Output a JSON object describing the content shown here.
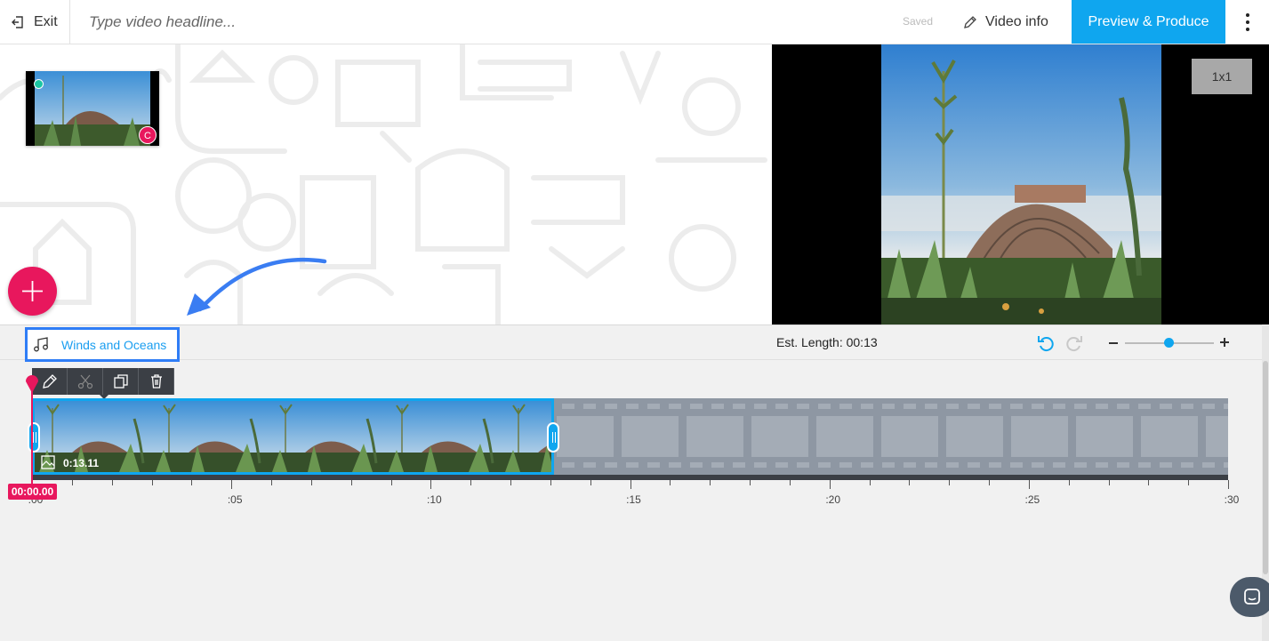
{
  "topbar": {
    "exit_label": "Exit",
    "headline_placeholder": "Type video headline...",
    "saved_label": "Saved",
    "video_info_label": "Video info",
    "preview_produce_label": "Preview & Produce"
  },
  "workspace": {
    "thumbnail_badge": "C"
  },
  "preview": {
    "ratio_label": "1x1"
  },
  "timeline_bar": {
    "music_track_name": "Winds and Oceans",
    "est_length": "Est. Length: 00:13",
    "zoom_level": 0.5
  },
  "clip": {
    "duration": "0:13.11"
  },
  "playhead": {
    "time": "00:00.00"
  },
  "ruler": {
    "labels": [
      ":00",
      ":05",
      ":10",
      ":15",
      ":20",
      ":25",
      ":30"
    ]
  },
  "colors": {
    "accent": "#0fa6ef",
    "brand_pink": "#e8175d",
    "highlight_blue": "#2f7df6"
  }
}
